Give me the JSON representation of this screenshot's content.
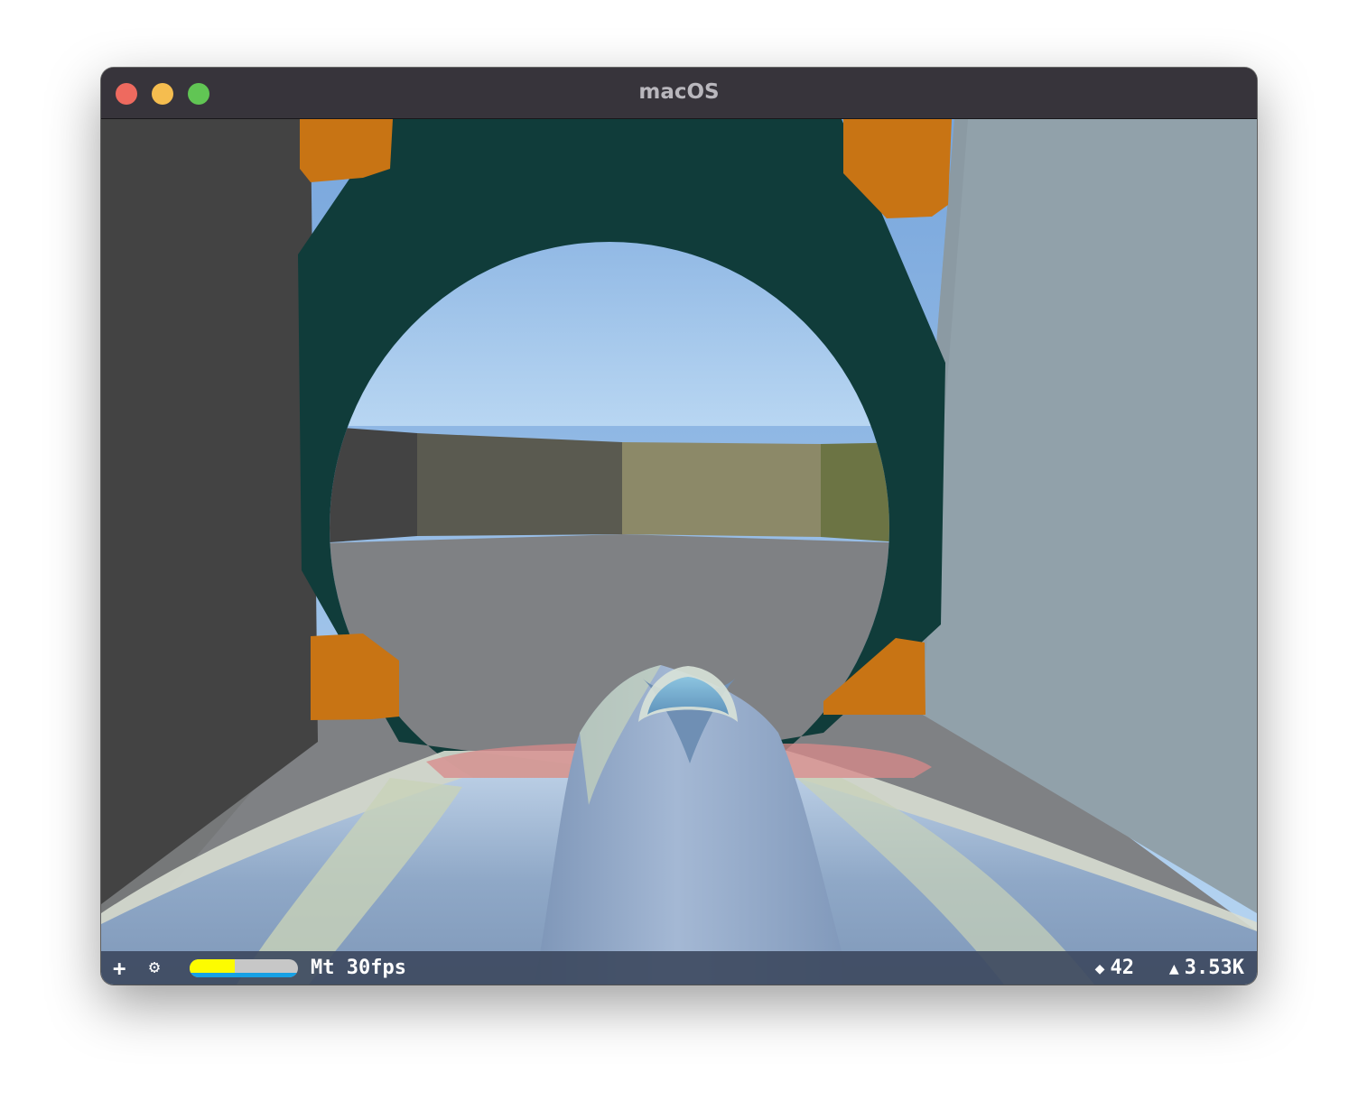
{
  "window": {
    "title": "macOS",
    "buttons": [
      "close",
      "minimize",
      "zoom"
    ]
  },
  "scene": {
    "description_icons": [
      "ring-gate",
      "spaceship"
    ],
    "colors": {
      "sky_top": "#78a6dc",
      "sky_bottom": "#b4d2f0",
      "ring": "#103c3a",
      "pillar": "#c87414",
      "left_wall": "#434343",
      "right_wall": "#91a1aa",
      "floor": "#7f8184",
      "ship": "#8aa6c8"
    }
  },
  "hud": {
    "add_icon": "+",
    "settings_icon": "⚙",
    "perf_cpu_fraction": 0.42,
    "perf_gpu_fraction": 1.0,
    "perf_cpu_color": "#fdfc00",
    "perf_gpu_color": "#17a1e5",
    "fps_text": "Mt 30fps",
    "nodes_icon": "◆",
    "nodes_value": "42",
    "triangles_icon": "▲",
    "triangles_value": "3.53K"
  }
}
